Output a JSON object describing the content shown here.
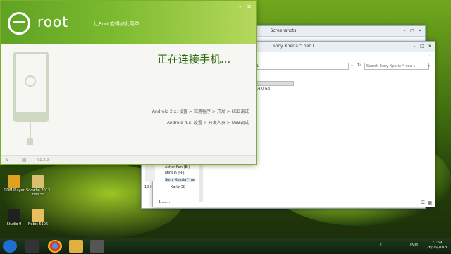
{
  "eroot": {
    "brand": "root",
    "tagline": "让Root变得如此简单",
    "status": "正在连接手机...",
    "step_android2": "Android 2.x: 设置 > 应用程序 > 开发 > USB调试",
    "step_android4": "Android 4.x: 设置 > 开发人员 > USB调试",
    "version": "V1.3.3"
  },
  "explorer_back": {
    "title": "Screenshots"
  },
  "explorer_front": {
    "title": "Sony Xperia™ neo L",
    "address": "neo L",
    "search_placeholder": "Search Sony Xperia™ neo L",
    "storage_info": "14,0 GB",
    "status_bar": "1 item",
    "back_status": "10 ite"
  },
  "nav_items": [
    "Achor Fun (E:)",
    "MICRO (H:)",
    "Sony Xperia™ ne",
    "Karty SB"
  ],
  "desktop_icons": [
    {
      "label": "Crowline",
      "color": "#c23030"
    },
    {
      "label": "GOM Player",
      "color": "#e0a020"
    },
    {
      "label": "Snowfie 2013 ftwn SB",
      "color": "#d8c070"
    },
    {
      "label": "Studio 9",
      "color": "#202020"
    },
    {
      "label": "Nobis 5105",
      "color": "#e8c060"
    }
  ],
  "taskbar": {
    "lang": "IND",
    "time": "21:59",
    "date": "28/06/2013"
  },
  "colors": {
    "accent": "#6fb22c",
    "status_text": "#2e6b0f"
  }
}
